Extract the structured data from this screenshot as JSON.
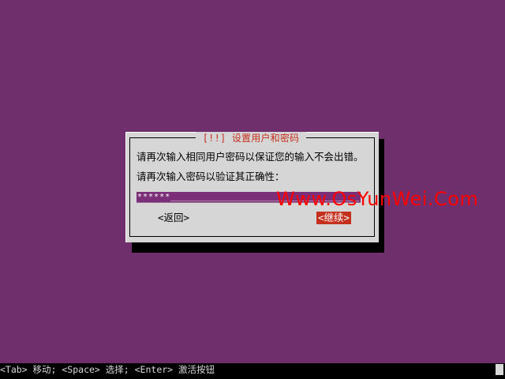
{
  "dialog": {
    "title": "[!!] 设置用户和密码",
    "line1": "请再次输入相同用户密码以保证您的输入不会出错。",
    "line2": "请再次输入密码以验证其正确性：",
    "password_value": "******",
    "back_button": "<返回>",
    "continue_button": "<继续>"
  },
  "watermark": "Www.OsYunWei.Com",
  "help": {
    "text": "<Tab> 移动; <Space> 选择; <Enter> 激活按钮"
  },
  "colors": {
    "background": "#6f2f6d",
    "dialog": "#d6d6d6",
    "title": "#c4301d",
    "selected_button": "#c4301d",
    "field": "#7b2f79",
    "watermark": "#ff0000"
  }
}
